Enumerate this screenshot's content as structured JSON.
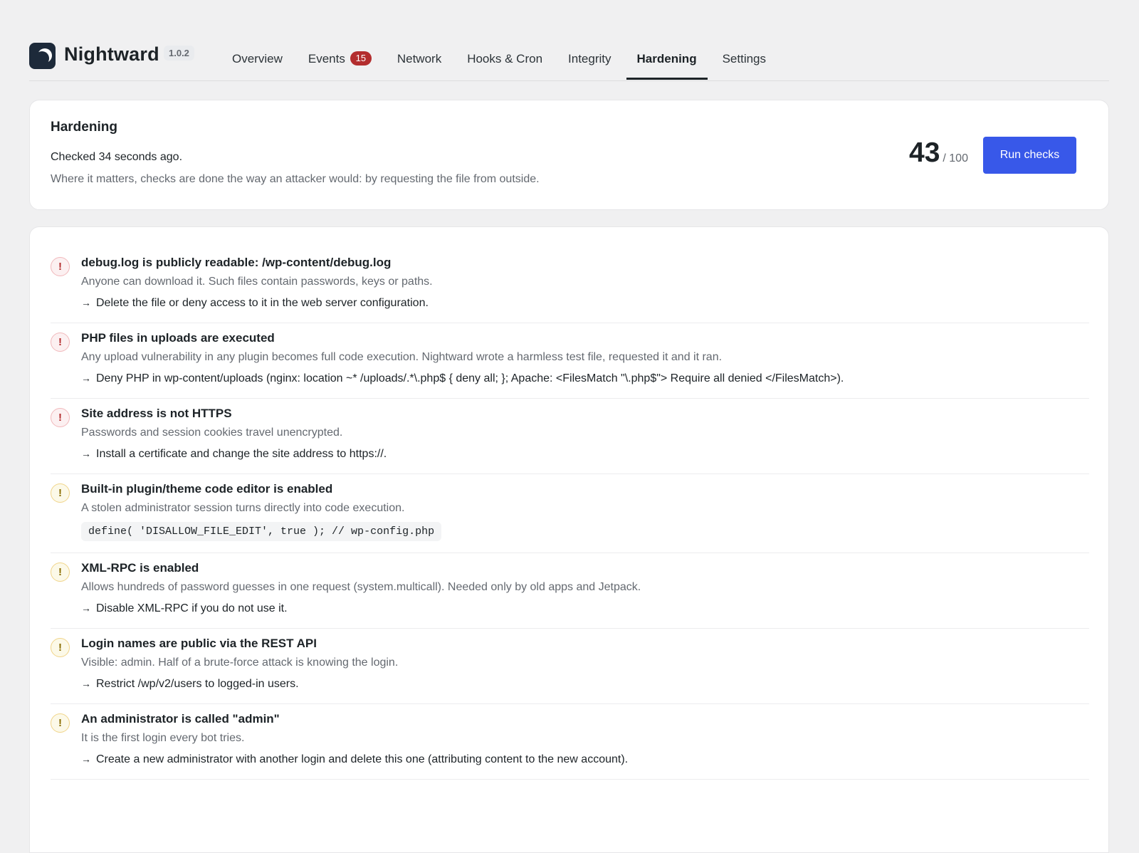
{
  "app": {
    "name": "Nightward",
    "version": "1.0.2",
    "logo_icon": "crescent-moon-icon"
  },
  "tabs": [
    {
      "label": "Overview",
      "active": false
    },
    {
      "label": "Events",
      "badge": "15",
      "active": false
    },
    {
      "label": "Network",
      "active": false
    },
    {
      "label": "Hooks & Cron",
      "active": false
    },
    {
      "label": "Integrity",
      "active": false
    },
    {
      "label": "Hardening",
      "active": true
    },
    {
      "label": "Settings",
      "active": false
    }
  ],
  "summary": {
    "title": "Hardening",
    "checked": "Checked 34 seconds ago.",
    "explanation": "Where it matters, checks are done the way an attacker would: by requesting the file from outside.",
    "score": "43",
    "score_max": "/ 100",
    "run_label": "Run checks"
  },
  "findings": [
    {
      "severity": "high",
      "icon": "!",
      "title": "debug.log is publicly readable: /wp-content/debug.log",
      "description": "Anyone can download it. Such files contain passwords, keys or paths.",
      "fix": "Delete the file or deny access to it in the web server configuration."
    },
    {
      "severity": "high",
      "icon": "!",
      "title": "PHP files in uploads are executed",
      "description": "Any upload vulnerability in any plugin becomes full code execution. Nightward wrote a harmless test file, requested it and it ran.",
      "fix": "Deny PHP in wp-content/uploads (nginx: location ~* /uploads/.*\\.php$ { deny all; }; Apache: <FilesMatch \"\\.php$\"> Require all denied </FilesMatch>)."
    },
    {
      "severity": "high",
      "icon": "!",
      "title": "Site address is not HTTPS",
      "description": "Passwords and session cookies travel unencrypted.",
      "fix": "Install a certificate and change the site address to https://."
    },
    {
      "severity": "medium",
      "icon": "!",
      "title": "Built-in plugin/theme code editor is enabled",
      "description": "A stolen administrator session turns directly into code execution.",
      "code": "define( 'DISALLOW_FILE_EDIT', true ); // wp-config.php"
    },
    {
      "severity": "medium",
      "icon": "!",
      "title": "XML-RPC is enabled",
      "description": "Allows hundreds of password guesses in one request (system.multicall). Needed only by old apps and Jetpack.",
      "fix": "Disable XML-RPC if you do not use it."
    },
    {
      "severity": "medium",
      "icon": "!",
      "title": "Login names are public via the REST API",
      "description": "Visible: admin. Half of a brute-force attack is knowing the login.",
      "fix": "Restrict /wp/v2/users to logged-in users."
    },
    {
      "severity": "medium",
      "icon": "!",
      "title": "An administrator is called \"admin\"",
      "description": "It is the first login every bot tries.",
      "fix": "Create a new administrator with another login and delete this one (attributing content to the new account)."
    }
  ],
  "arrow_glyph": "→",
  "colors": {
    "accent": "#3858e9",
    "badge": "#b32d2e",
    "high": "#b32d2e",
    "medium": "#8a6d00"
  }
}
